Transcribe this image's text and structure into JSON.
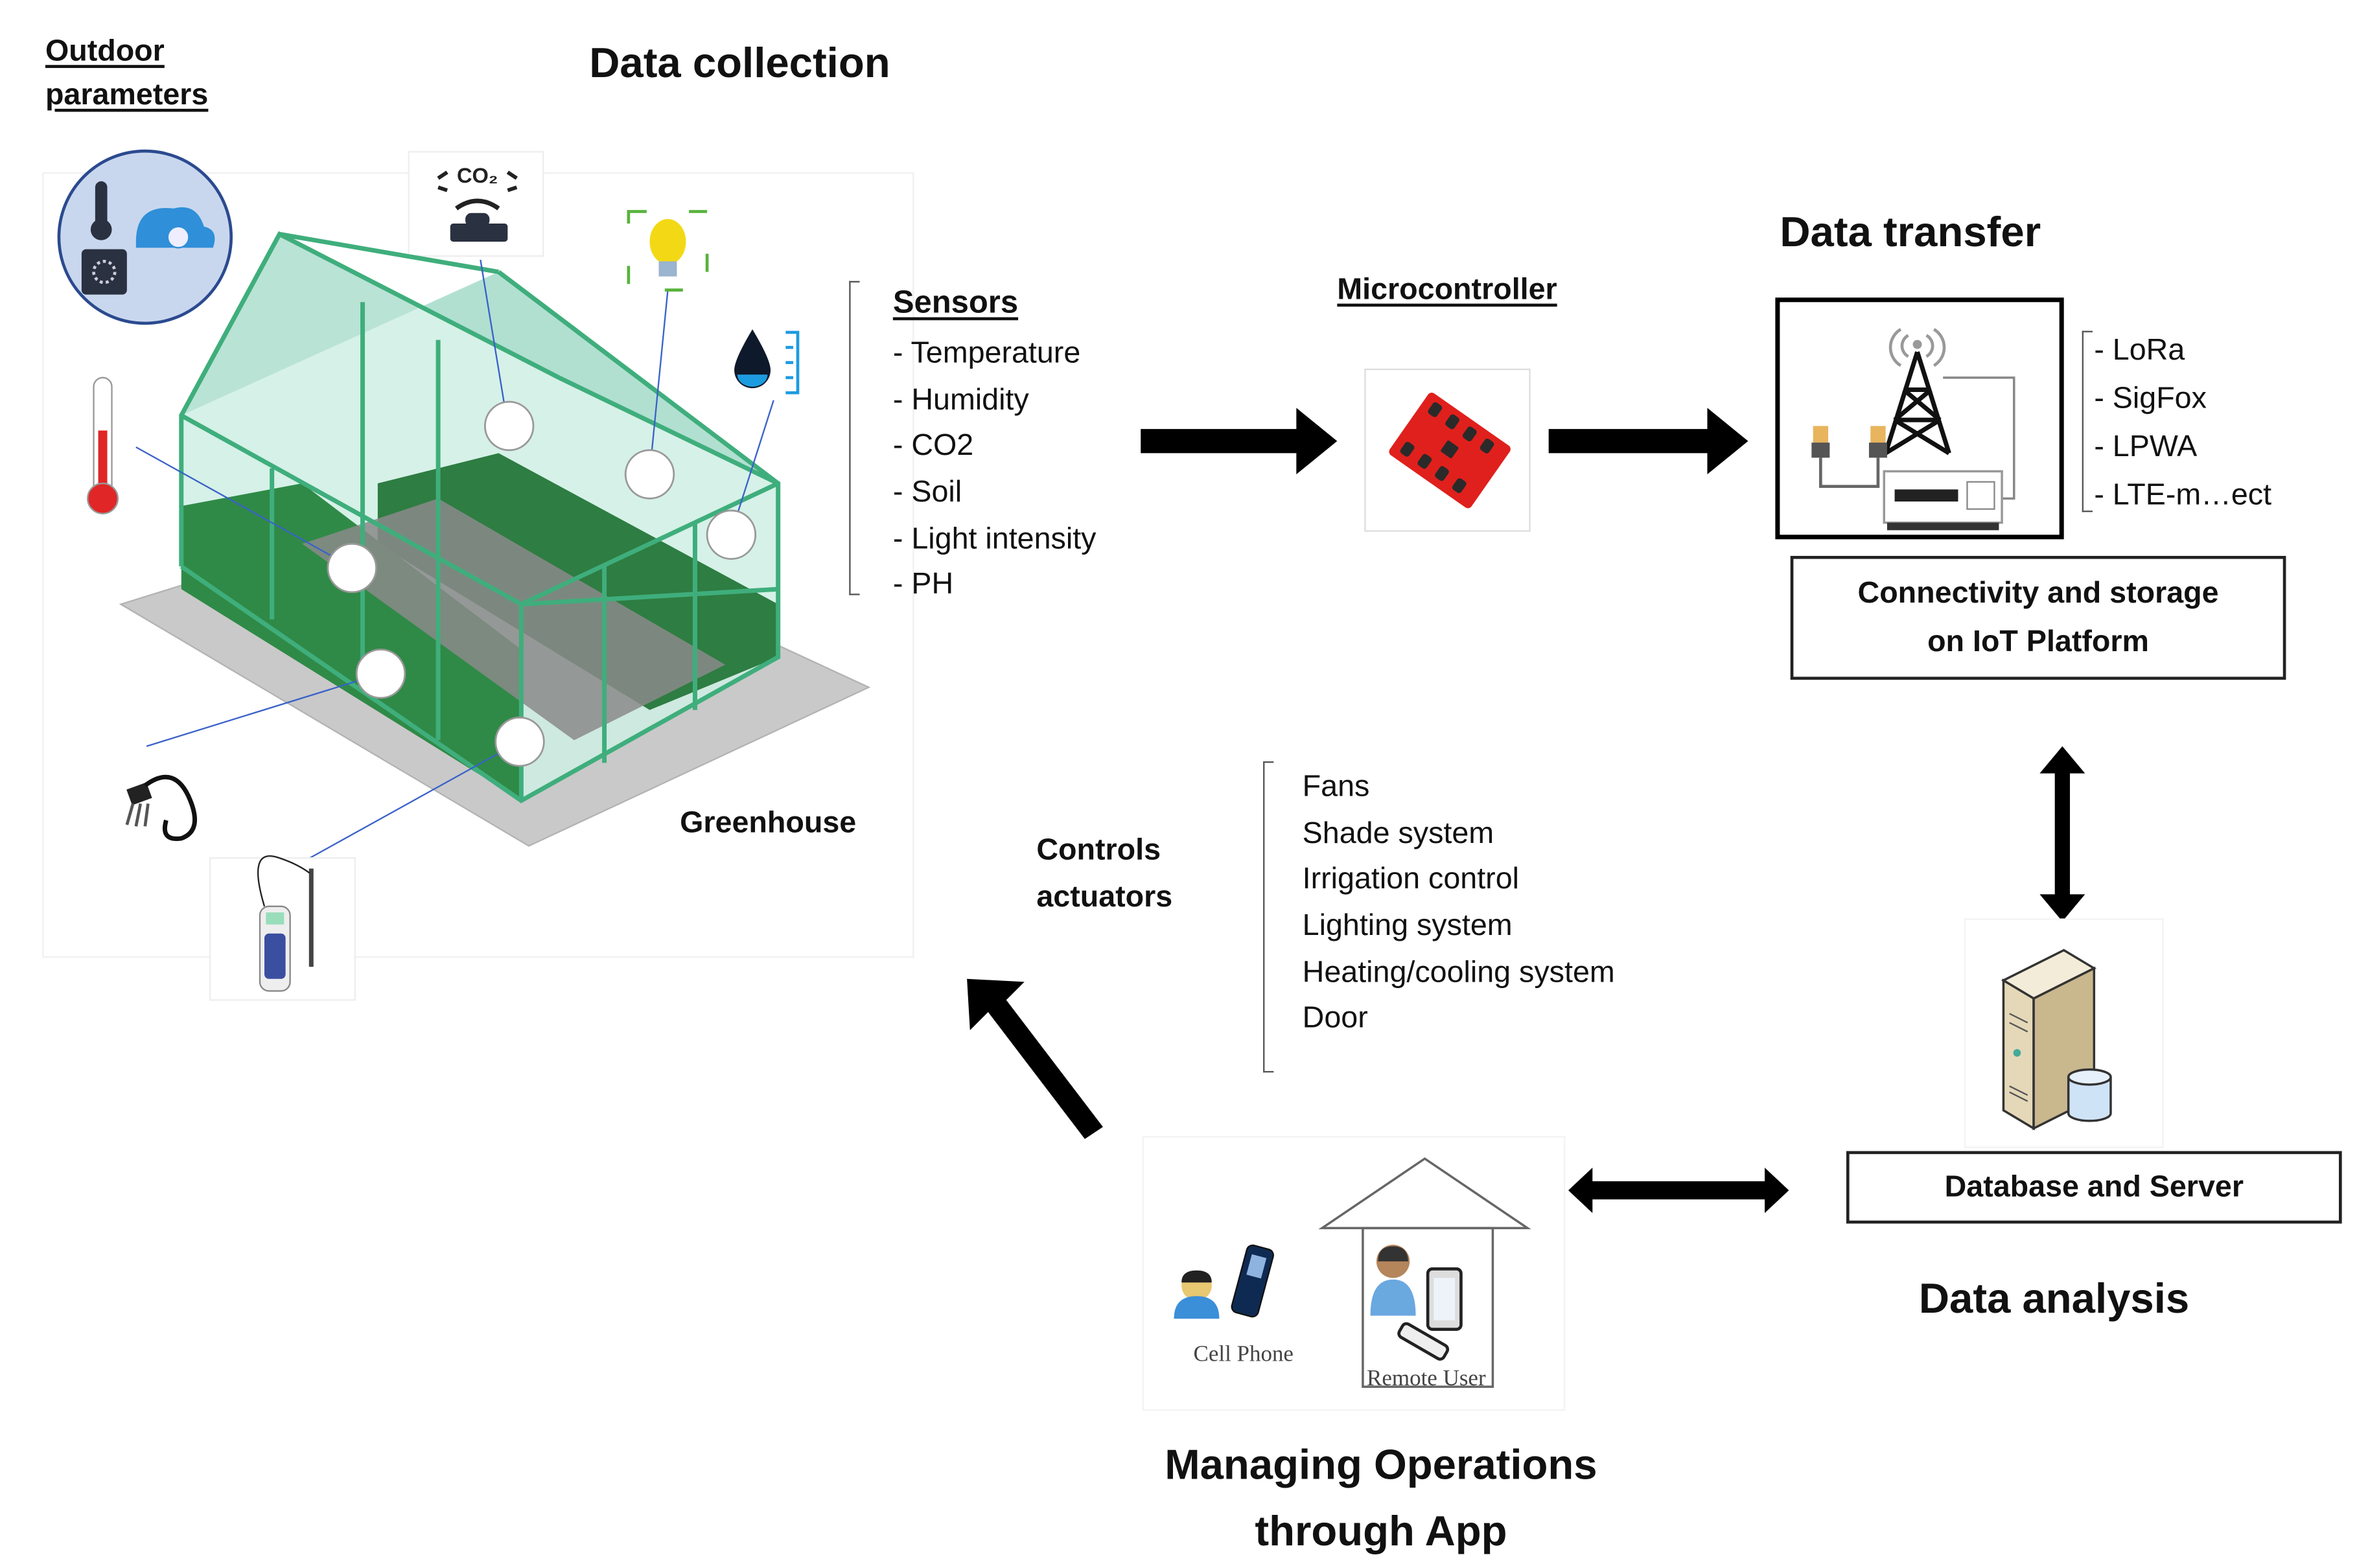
{
  "sections": {
    "data_collection": {
      "title": "Data collection"
    },
    "outdoor": {
      "label_line1": "Outdoor",
      "label_line2": "parameters"
    },
    "greenhouse": {
      "label": "Greenhouse"
    },
    "sensors": {
      "heading": "Sensors",
      "items": [
        "- Temperature",
        "- Humidity",
        "- CO2",
        "- Soil",
        "- Light intensity",
        "- PH"
      ]
    },
    "microcontroller": {
      "heading": "Microcontroller"
    },
    "data_transfer": {
      "title": "Data transfer",
      "protocols": [
        "- LoRa",
        "- SigFox",
        "- LPWA",
        "- LTE-m…ect"
      ],
      "platform_box_line1": "Connectivity and storage",
      "platform_box_line2": "on IoT Platform"
    },
    "data_analysis": {
      "title": "Data analysis",
      "server_box": "Database and Server"
    },
    "actuators": {
      "label_line1": "Controls",
      "label_line2": "actuators",
      "items": [
        "Fans",
        "Shade system",
        "Irrigation control",
        "Lighting system",
        "Heating/cooling system",
        "Door"
      ]
    },
    "app": {
      "title_line1": "Managing Operations",
      "title_line2": "through App",
      "cell_phone_label": "Cell Phone",
      "remote_user_label": "Remote User"
    }
  },
  "icons": {
    "co2_sensor": "CO₂"
  },
  "colors": {
    "greenhouse_frame": "#3fae7c",
    "greenhouse_glass": "#bfe6da",
    "plants": "#2e7d42",
    "microcontroller": "#e0201c",
    "connector_line": "#3a62c8"
  }
}
